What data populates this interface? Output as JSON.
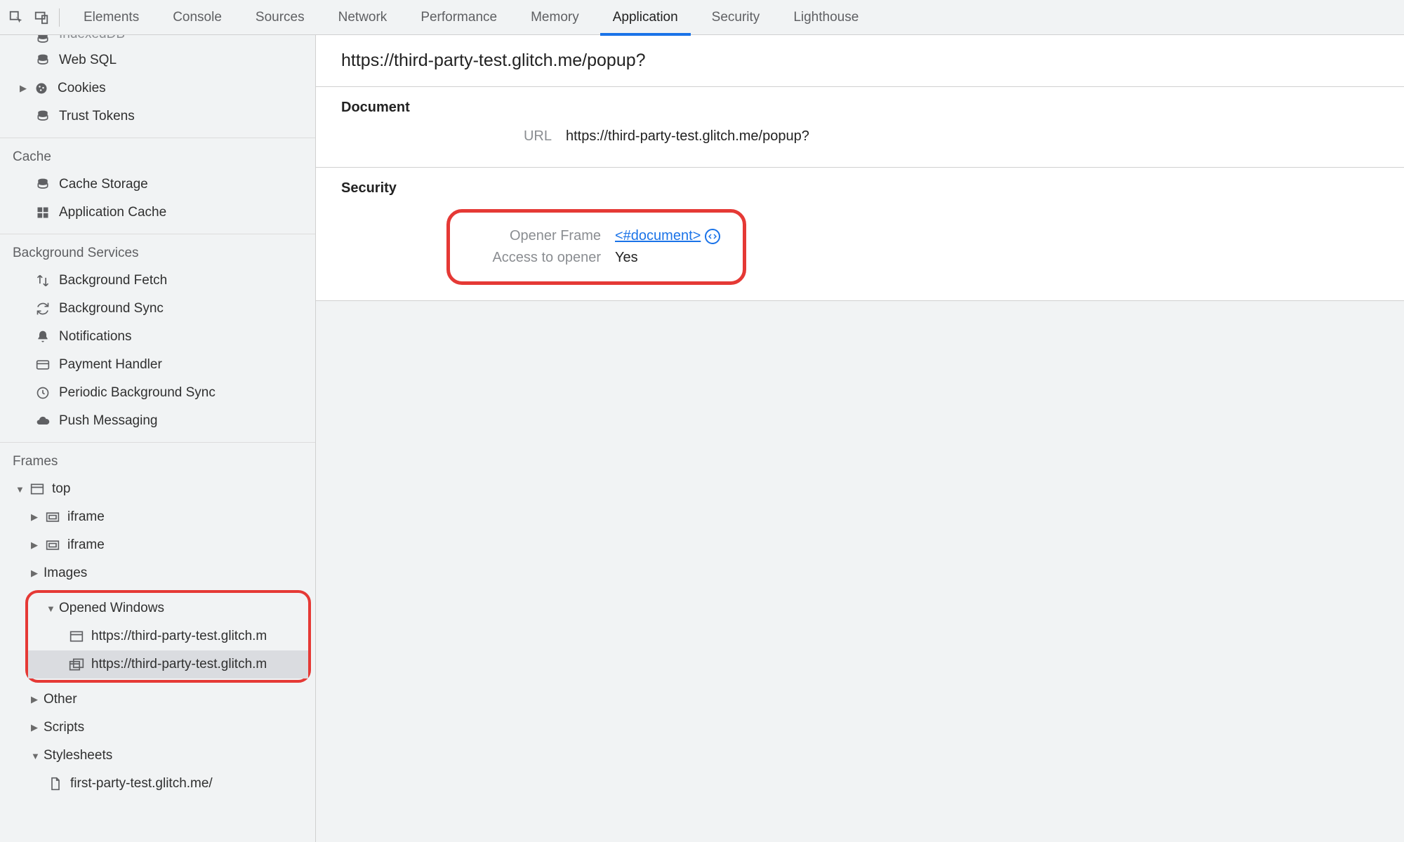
{
  "tabs": {
    "items": [
      "Elements",
      "Console",
      "Sources",
      "Network",
      "Performance",
      "Memory",
      "Application",
      "Security",
      "Lighthouse"
    ],
    "active": "Application"
  },
  "sidebar": {
    "storage": {
      "indexeddb": "IndexedDB",
      "websql": "Web SQL",
      "cookies": "Cookies",
      "trust": "Trust Tokens"
    },
    "cache": {
      "title": "Cache",
      "cachestorage": "Cache Storage",
      "appcache": "Application Cache"
    },
    "bg": {
      "title": "Background Services",
      "fetch": "Background Fetch",
      "sync": "Background Sync",
      "notif": "Notifications",
      "payment": "Payment Handler",
      "periodic": "Periodic Background Sync",
      "push": "Push Messaging"
    },
    "frames": {
      "title": "Frames",
      "top": "top",
      "iframe": "iframe",
      "images": "Images",
      "opened": "Opened Windows",
      "win1": "https://third-party-test.glitch.m",
      "win2": "https://third-party-test.glitch.m",
      "other": "Other",
      "scripts": "Scripts",
      "stylesheets": "Stylesheets",
      "stylefile": "first-party-test.glitch.me/"
    }
  },
  "detail": {
    "title": "https://third-party-test.glitch.me/popup?",
    "doc": {
      "heading": "Document",
      "url_label": "URL",
      "url_value": "https://third-party-test.glitch.me/popup?"
    },
    "sec": {
      "heading": "Security",
      "opener_label": "Opener Frame",
      "opener_value": "<#document>",
      "access_label": "Access to opener",
      "access_value": "Yes"
    }
  }
}
